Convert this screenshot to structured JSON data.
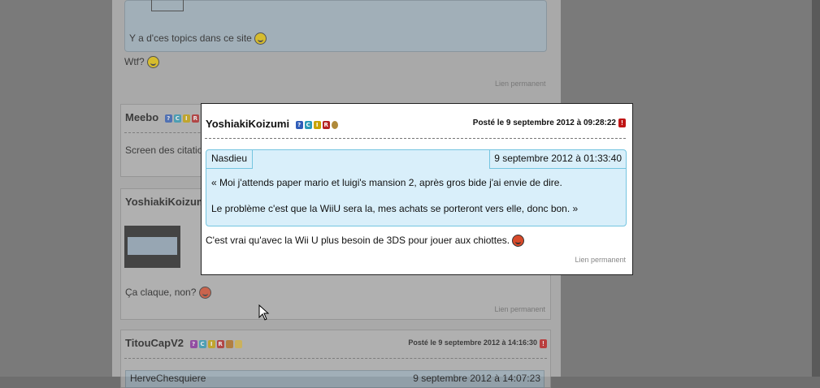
{
  "background_posts": {
    "top_fragment": {
      "line1": "Y a d'ces topics dans ce site",
      "line2": "Wtf?",
      "permalink": "Lien permanent"
    },
    "meebo": {
      "author": "Meebo",
      "body": "Screen des citatio"
    },
    "yoshiaki": {
      "author": "YoshiakiKoizumi",
      "body": "Ça claque, non?",
      "permalink": "Lien permanent"
    },
    "titou": {
      "author": "TitouCapV2",
      "date": "Posté le 9 septembre 2012 à 14:16:30",
      "quote_author": "HerveChesquiere",
      "quote_date": "9 septembre 2012 à 14:07:23"
    }
  },
  "popup": {
    "author": "YoshiakiKoizumi",
    "date": "Posté le 9 septembre 2012 à 09:28:22",
    "quote": {
      "author": "Nasdieu",
      "date": "9 septembre 2012 à 01:33:40",
      "line1": "« Moi j'attends paper mario et luigi's mansion 2, après gros bide j'ai envie de dire.",
      "line2": "Le problème c'est que la WiiU sera la, mes achats se porteront vers elle, donc bon. »"
    },
    "body": "C'est vrai qu'avec la Wii U plus besoin de 3DS pour jouer aux chiottes.",
    "permalink": "Lien permanent"
  },
  "colors": {
    "quote_bg": "#d9effa",
    "quote_border": "#75c5e0",
    "overlay": "#7a7a7a"
  }
}
